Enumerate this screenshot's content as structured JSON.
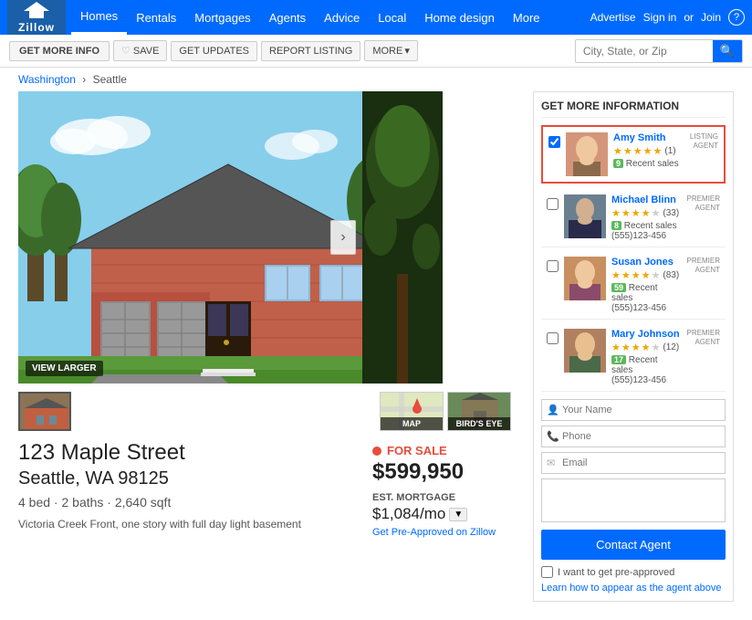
{
  "topNav": {
    "logo": "Z",
    "logoText": "Zillow",
    "links": [
      "Homes",
      "Rentals",
      "Mortgages",
      "Agents",
      "Advice",
      "Local",
      "Home design",
      "More"
    ],
    "activeLink": "Homes",
    "right": {
      "advertise": "Advertise",
      "signin": "Sign in",
      "or": "or",
      "join": "Join",
      "help": "?"
    }
  },
  "subNav": {
    "getMoreInfo": "GET MORE INFO",
    "save": "SAVE",
    "getUpdates": "GET UPDATES",
    "reportListing": "REPORT LISTING",
    "more": "MORE",
    "searchPlaceholder": "City, State, or Zip"
  },
  "breadcrumb": {
    "state": "Washington",
    "sep": "›",
    "city": "Seattle"
  },
  "property": {
    "address": "123 Maple Street",
    "cityStateZip": "Seattle, WA 98125",
    "details": "4 bed · 2 baths · 2,640 sqft",
    "description": "Victoria Creek Front, one story with full day light basement",
    "viewLarger": "VIEW LARGER",
    "mapLabel": "MAP",
    "birdsEyeLabel": "BIRD'S EYE"
  },
  "pricing": {
    "forSaleLabel": "FOR SALE",
    "price": "$599,950",
    "mortgageLabel": "EST. MORTGAGE",
    "mortgageAmount": "$1,084/mo",
    "preApproveLink": "Get Pre-Approved on Zillow"
  },
  "agents": {
    "sectionTitle": "GET MORE INFORMATION",
    "items": [
      {
        "name": "Amy Smith",
        "badge": "LISTING\nAGENT",
        "stars": 5,
        "ratingCount": "(1)",
        "recentSales": "9",
        "recentSalesLabel": "Recent sales",
        "phone": "",
        "selected": true,
        "ratingNum": "5"
      },
      {
        "name": "Michael Blinn",
        "badge": "PREMIER\nAGENT",
        "stars": 4,
        "ratingCount": "(33)",
        "recentSales": "8",
        "recentSalesLabel": "Recent sales",
        "phone": "(555)123-456",
        "selected": false,
        "ratingNum": "4"
      },
      {
        "name": "Susan Jones",
        "badge": "PREMIER\nAGENT",
        "stars": 4,
        "ratingCount": "(83)",
        "recentSales": "59",
        "recentSalesLabel": "Recent sales",
        "phone": "(555)123-456",
        "selected": false,
        "ratingNum": "4"
      },
      {
        "name": "Mary Johnson",
        "badge": "PREMIER\nAGENT",
        "stars": 4,
        "ratingCount": "(12)",
        "recentSales": "17",
        "recentSalesLabel": "Recent sales",
        "phone": "(555)123-456",
        "selected": false,
        "ratingNum": "4"
      }
    ],
    "form": {
      "namePlaceholder": "Your Name",
      "phonePlaceholder": "Phone",
      "emailPlaceholder": "Email",
      "contactBtn": "Contact Agent",
      "preApproveLabel": "I want to get pre-approved",
      "appearLink": "Learn how to appear as the agent above"
    }
  }
}
